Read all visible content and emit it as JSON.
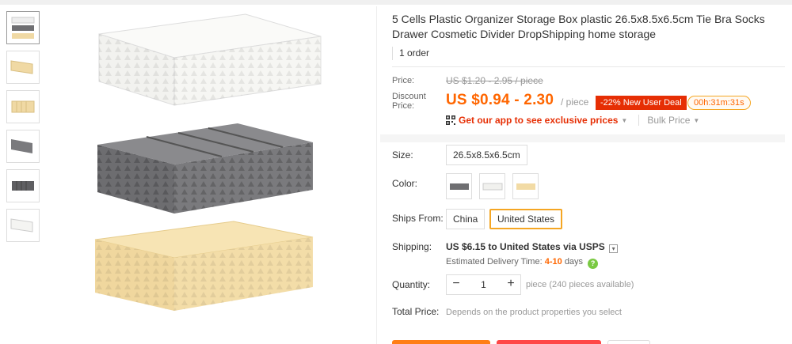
{
  "product": {
    "title": "5 Cells Plastic Organizer Storage Box plastic 26.5x8.5x6.5cm Tie Bra Socks Drawer Cosmetic Divider DropShipping home storage",
    "orders": "1 order"
  },
  "price": {
    "label": "Price:",
    "original": "US $1.20 - 2.95 / piece",
    "discount_label_1": "Discount",
    "discount_label_2": "Price:",
    "discount": "US $0.94 - 2.30",
    "unit": "/ piece",
    "badge": "-22% New User Deal",
    "countdown": "00h:31m:31s",
    "app_link": "Get our app to see exclusive prices",
    "bulk": "Bulk Price"
  },
  "options": {
    "size_label": "Size:",
    "size_value": "26.5x8.5x6.5cm",
    "color_label": "Color:",
    "colors": [
      "gray",
      "white",
      "beige"
    ],
    "ships_from_label": "Ships From:",
    "ships_from": [
      "China",
      "United States"
    ],
    "ships_from_selected": "United States"
  },
  "shipping": {
    "label": "Shipping:",
    "cost": "US $6.15",
    "dest": "to United States via USPS",
    "est_prefix": "Estimated Delivery Time:",
    "est_days": "4-10",
    "est_suffix": "days"
  },
  "quantity": {
    "label": "Quantity:",
    "value": "1",
    "available": "piece (240 pieces available)"
  },
  "total": {
    "label": "Total Price:",
    "value": "Depends on the product properties you select"
  },
  "colors": {
    "accent": "#ff6600",
    "badge_red": "#e62e04",
    "gray_box": "#77777a",
    "white_box": "#f1f1ee",
    "beige_box": "#f2dba5"
  }
}
